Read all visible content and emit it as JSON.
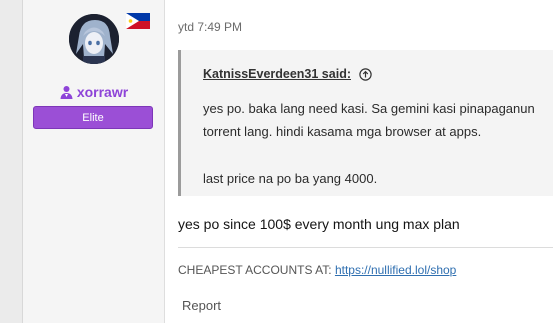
{
  "post": {
    "user": {
      "username": "xorrawr",
      "rank": "Elite",
      "avatar_icon": "avatar-anime-character",
      "flag_icon": "flag-philippines",
      "username_color": "#8e44d8",
      "rank_color": "#9b4fd6"
    },
    "timestamp": "ytd 7:49 PM",
    "quote": {
      "author": "KatnissEverdeen31 said:",
      "lines": [
        "yes po. baka lang need kasi. Sa gemini kasi pinapaganun",
        "torrent lang. hindi kasama mga browser at apps.",
        "last price na po ba yang 4000."
      ]
    },
    "reply": "yes po since 100$ every month ung max plan",
    "signature": {
      "prefix": "CHEAPEST ACCOUNTS AT:",
      "link": "https://nullified.lol/shop"
    },
    "report_label": "Report"
  }
}
